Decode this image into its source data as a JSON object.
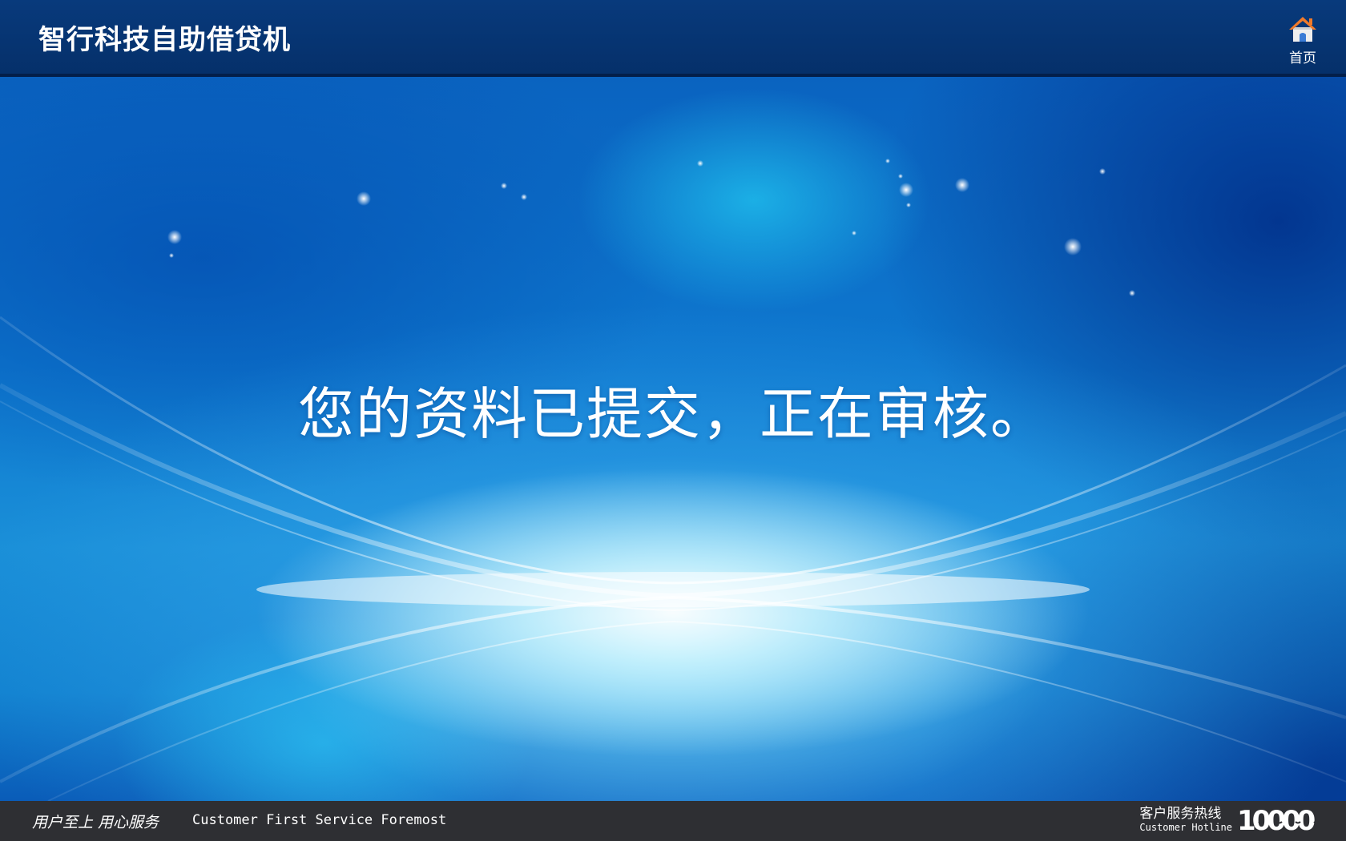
{
  "header": {
    "app_title": "智行科技自助借贷机",
    "home_label": "首页"
  },
  "main": {
    "status_message": "您的资料已提交，正在审核。"
  },
  "footer": {
    "slogan_cn": "用户至上 用心服务",
    "slogan_en": "Customer First Service Foremost",
    "hotline_label_cn": "客户服务热线",
    "hotline_label_en": "Customer Hotline",
    "hotline_number": "10000"
  },
  "icons": {
    "home": "home-icon"
  },
  "colors": {
    "header_bg": "#05306a",
    "footer_bg": "#2e2f33",
    "home_roof": "#f07a2a",
    "text": "#ffffff"
  }
}
